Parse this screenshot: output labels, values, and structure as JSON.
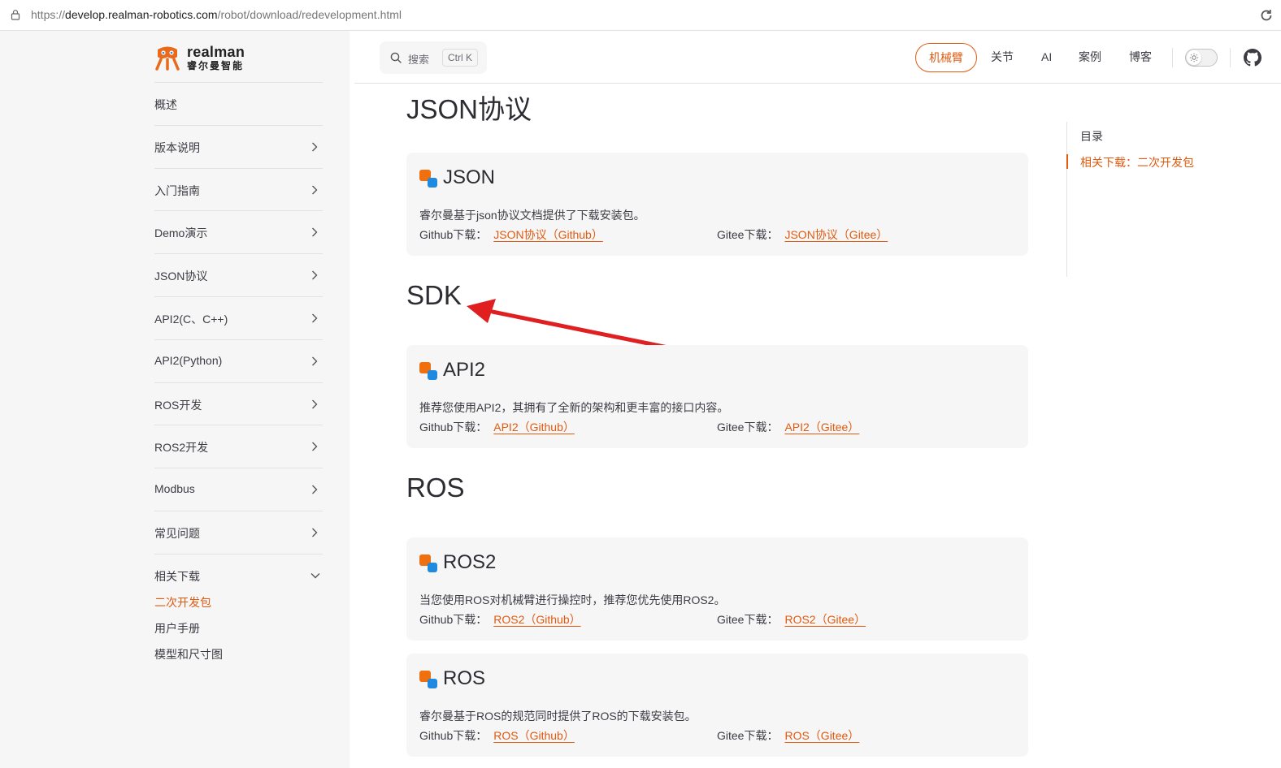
{
  "browser": {
    "url_prefix": "https://",
    "url_host": "develop.realman-robotics.com",
    "url_path": "/robot/download/redevelopment.html"
  },
  "logo": {
    "brand": "realman",
    "brand_cn": "睿尔曼智能"
  },
  "sidebar": {
    "items": [
      {
        "label": "概述"
      },
      {
        "label": "版本说明"
      },
      {
        "label": "入门指南"
      },
      {
        "label": "Demo演示"
      },
      {
        "label": "JSON协议"
      },
      {
        "label": "API2(C、C++)"
      },
      {
        "label": "API2(Python)"
      },
      {
        "label": "ROS开发"
      },
      {
        "label": "ROS2开发"
      },
      {
        "label": "Modbus"
      },
      {
        "label": "常见问题"
      }
    ],
    "group": {
      "label": "相关下载",
      "subs": [
        "二次开发包",
        "用户手册",
        "模型和尺寸图"
      ],
      "active_index": 0
    }
  },
  "search": {
    "placeholder": "搜索",
    "shortcut": "Ctrl K"
  },
  "topnav": {
    "items": [
      "机械臂",
      "关节",
      "AI",
      "案例",
      "博客"
    ],
    "active_index": 0
  },
  "content": {
    "headings": [
      "JSON协议",
      "SDK",
      "ROS"
    ],
    "cards": [
      {
        "title": "JSON",
        "desc": "睿尔曼基于json协议文档提供了下载安装包。",
        "github_label": "Github下载：",
        "github_link": "JSON协议（Github）",
        "gitee_label": "Gitee下载：",
        "gitee_link": "JSON协议（Gitee）"
      },
      {
        "title": "API2",
        "desc": "推荐您使用API2，其拥有了全新的架构和更丰富的接口内容。",
        "github_label": "Github下载：",
        "github_link": "API2（Github）",
        "gitee_label": "Gitee下载：",
        "gitee_link": "API2（Gitee）"
      },
      {
        "title": "ROS2",
        "desc": "当您使用ROS对机械臂进行操控时，推荐您优先使用ROS2。",
        "github_label": "Github下载：",
        "github_link": "ROS2（Github）",
        "gitee_label": "Gitee下载：",
        "gitee_link": "ROS2（Gitee）"
      },
      {
        "title": "ROS",
        "desc": "睿尔曼基于ROS的规范同时提供了ROS的下载安装包。",
        "github_label": "Github下载：",
        "github_link": "ROS（Github）",
        "gitee_label": "Gitee下载：",
        "gitee_link": "ROS（Gitee）"
      }
    ]
  },
  "outline": {
    "title": "目录",
    "items": [
      "相关下载：二次开发包"
    ]
  },
  "colors": {
    "accent": "#e05a10",
    "annotation": "#e02020",
    "sidebar_bg": "#f6f6f7"
  },
  "icons": [
    "lock-icon",
    "refresh-icon",
    "search-icon",
    "chevron-right-icon",
    "chevron-down-icon",
    "sun-icon",
    "github-icon",
    "card-icon",
    "annotation-arrow"
  ]
}
